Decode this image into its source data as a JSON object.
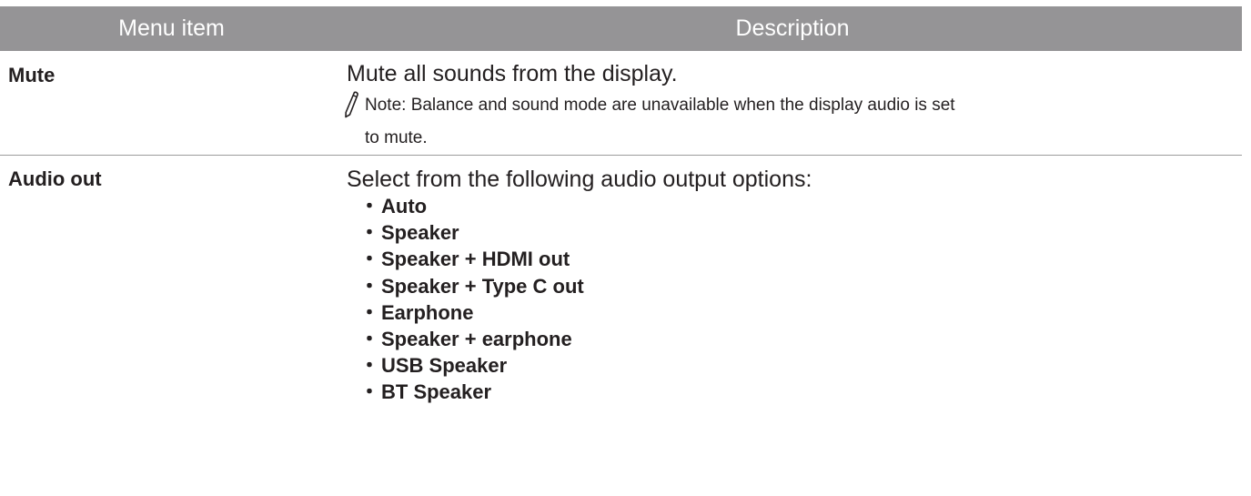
{
  "table": {
    "headers": {
      "item": "Menu item",
      "description": "Description"
    },
    "rows": {
      "mute": {
        "name": "Mute",
        "description": "Mute all sounds from the display.",
        "note_line1": "Note: Balance and sound mode are unavailable when the display audio is set",
        "note_line2": "to mute.",
        "note_icon": "pencil-icon"
      },
      "audio_out": {
        "name": "Audio out",
        "description": "Select from the following audio output options:",
        "bullet": "・",
        "options": [
          "Auto",
          "Speaker",
          "Speaker + HDMI out",
          "Speaker + Type C out",
          "Earphone",
          "Speaker + earphone",
          "USB Speaker",
          "BT Speaker"
        ]
      }
    }
  },
  "colors": {
    "header_bg": "#959496",
    "header_text": "#ffffff",
    "body_text": "#231f20",
    "divider": "#9c9c9c"
  }
}
